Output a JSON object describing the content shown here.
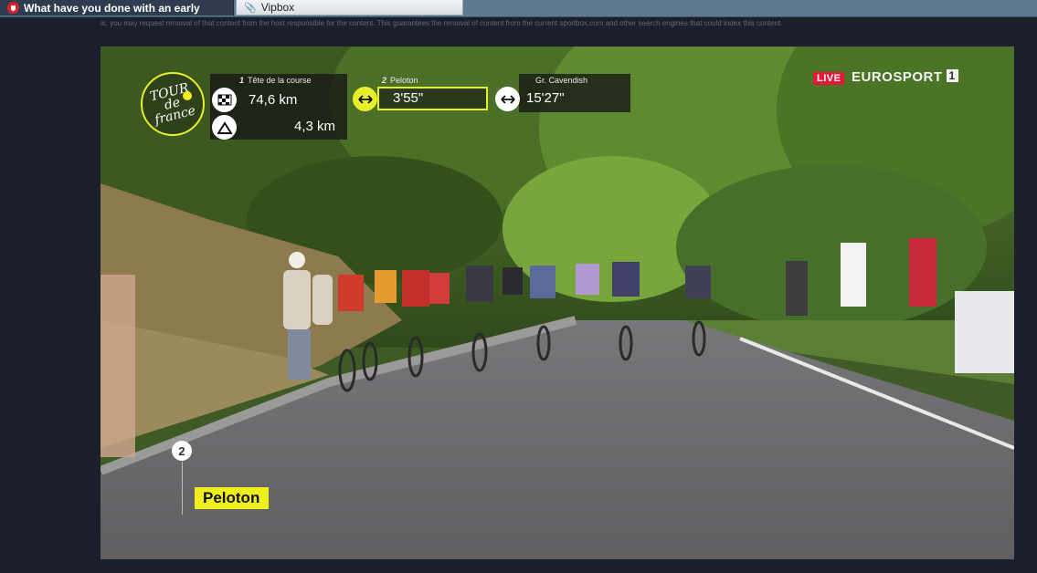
{
  "tabs": [
    {
      "label": "What have you done with an early",
      "active": true,
      "icon": "red-shield-icon"
    },
    {
      "label": "Vipbox",
      "active": false,
      "icon": "pin-icon"
    }
  ],
  "page": {
    "notice_text": "is, you may request removal of that content from the host responsible for the content. This guarantees the removal of content from the current sportbox.com and other search engines that could index this content."
  },
  "broadcast": {
    "logo_text_line1": "TOUR",
    "logo_text_line2": "de",
    "logo_text_line3": "france",
    "head": {
      "num": "1",
      "label": "Tête de la course",
      "distance": "74,6 km",
      "climb": "4,3 km"
    },
    "peloton": {
      "num": "2",
      "label": "Peloton",
      "gap": "3'55\""
    },
    "cavendish": {
      "label": "Gr. Cavendish",
      "gap": "15'27\""
    },
    "live": "LIVE",
    "channel": "EUROSPORT",
    "channel_number": "1",
    "group_number": "2",
    "group_label": "Peloton"
  },
  "colors": {
    "accent_yellow": "#e6ef2a",
    "live_red": "#e8173a"
  }
}
